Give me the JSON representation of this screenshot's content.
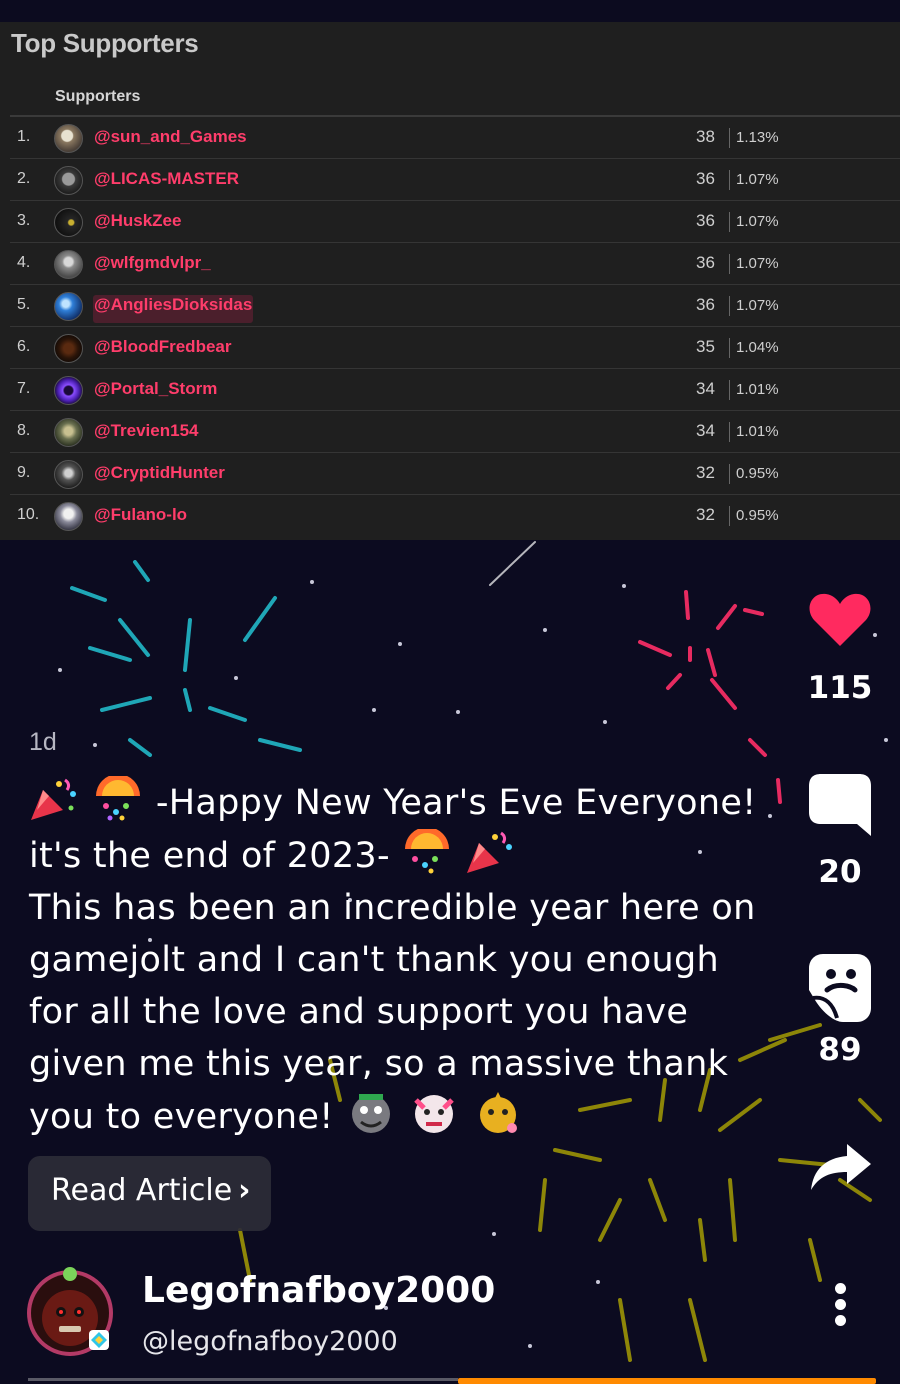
{
  "supporters_panel": {
    "title": "Top Supporters",
    "column_header": "Supporters",
    "rows": [
      {
        "rank": "1.",
        "name": "@sun_and_Games",
        "count": "38",
        "percent": "1.13%"
      },
      {
        "rank": "2.",
        "name": "@LICAS-MASTER",
        "count": "36",
        "percent": "1.07%"
      },
      {
        "rank": "3.",
        "name": "@HuskZee",
        "count": "36",
        "percent": "1.07%"
      },
      {
        "rank": "4.",
        "name": "@wlfgmdvlpr_",
        "count": "36",
        "percent": "1.07%"
      },
      {
        "rank": "5.",
        "name": "@AngliesDioksidas",
        "count": "36",
        "percent": "1.07%"
      },
      {
        "rank": "6.",
        "name": "@BloodFredbear",
        "count": "35",
        "percent": "1.04%"
      },
      {
        "rank": "7.",
        "name": "@Portal_Storm",
        "count": "34",
        "percent": "1.01%"
      },
      {
        "rank": "8.",
        "name": "@Trevien154",
        "count": "34",
        "percent": "1.01%"
      },
      {
        "rank": "9.",
        "name": "@CryptidHunter",
        "count": "32",
        "percent": "0.95%"
      },
      {
        "rank": "10.",
        "name": "@Fulano-lo",
        "count": "32",
        "percent": "0.95%"
      }
    ]
  },
  "post": {
    "timestamp": "1d",
    "caption_line1": " -Happy New Year's Eve Everyone!",
    "caption_line2_a": "it's the end of 2023- ",
    "caption_body": "This has been an incredible year here on gamejolt and I can't thank you enough for all the love and support you have given me this year, so a massive thank you to everyone! ",
    "read_article_label": "Read Article",
    "author_name": "Legofnafboy2000",
    "author_handle": "@legofnafboy2000"
  },
  "actions": {
    "likes": "115",
    "comments": "20",
    "stickers": "89",
    "icons": [
      "heart-icon",
      "comment-icon",
      "sticker-icon",
      "share-icon",
      "more-icon"
    ]
  },
  "colors": {
    "username": "#ff3d6b",
    "like": "#ff2a5f",
    "progress": "#ff8a00",
    "panel_bg": "#1f1f1f",
    "video_bg": "#0c0b20"
  },
  "playback_progress": 0.5
}
